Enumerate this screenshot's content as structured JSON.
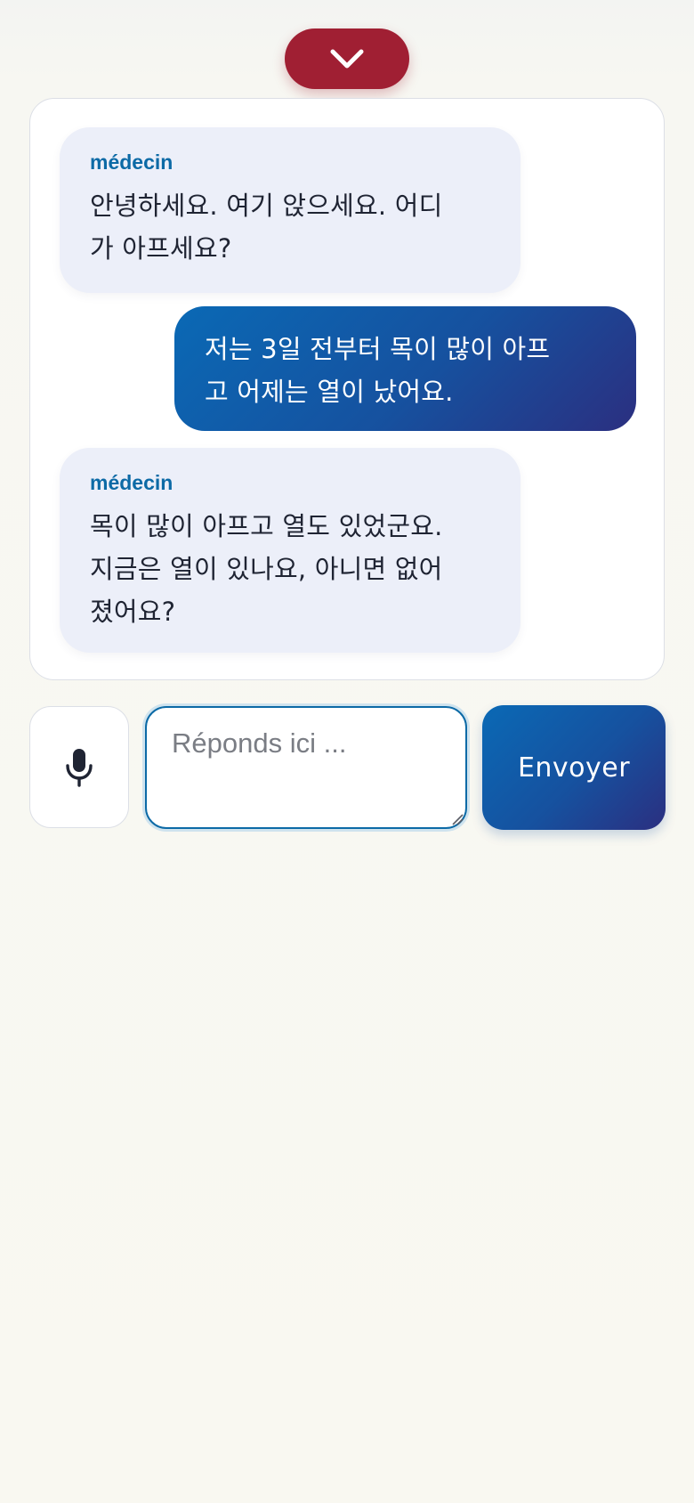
{
  "header": {
    "collapse_icon": "chevron-down-icon",
    "accent_color": "#a01f33"
  },
  "chat": {
    "messages": [
      {
        "role": "incoming",
        "sender": "médecin",
        "lines": [
          "안녕하세요. 여기 앉으세요. 어디",
          "가 아프세요?"
        ]
      },
      {
        "role": "outgoing",
        "lines": [
          "저는 3일 전부터 목이 많이 아프",
          "고 어제는 열이 났어요."
        ]
      },
      {
        "role": "incoming",
        "sender": "médecin",
        "lines": [
          "목이 많이 아프고 열도 있었군요.",
          "지금은 열이 있나요, 아니면 없어",
          "졌어요?"
        ]
      }
    ]
  },
  "composer": {
    "mic_icon": "microphone-icon",
    "placeholder": "Réponds ici ...",
    "value": "",
    "send_label": "Envoyer"
  },
  "colors": {
    "incoming_bubble": "#eceff9",
    "sender_label": "#0c6aa6",
    "outgoing_gradient_start": "#0a69b5",
    "outgoing_gradient_end": "#2b2f80"
  }
}
